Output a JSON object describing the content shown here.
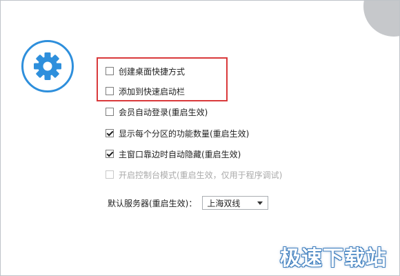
{
  "settings": {
    "options": [
      {
        "label": "创建桌面快捷方式",
        "checked": false,
        "enabled": true
      },
      {
        "label": "添加到快速启动栏",
        "checked": false,
        "enabled": true
      },
      {
        "label": "会员自动登录(重启生效)",
        "checked": false,
        "enabled": true
      },
      {
        "label": "显示每个分区的功能数量(重启生效)",
        "checked": true,
        "enabled": true
      },
      {
        "label": "主窗口靠边时自动隐藏(重启生效)",
        "checked": true,
        "enabled": true
      },
      {
        "label": "开启控制台模式(重启生效，仅用于程序调试)",
        "checked": false,
        "enabled": false
      }
    ],
    "server_label": "默认服务器(重启生效)：",
    "server_value": "上海双线"
  },
  "watermark": "极速下载站",
  "icons": {
    "settings": "gear-icon",
    "close": "close-icon",
    "dropdown": "chevron-down-icon"
  },
  "colors": {
    "accent": "#2e8fdc",
    "highlight": "#d9383a",
    "close_bg": "#c6c8cb",
    "watermark": "#3f7fbf"
  }
}
